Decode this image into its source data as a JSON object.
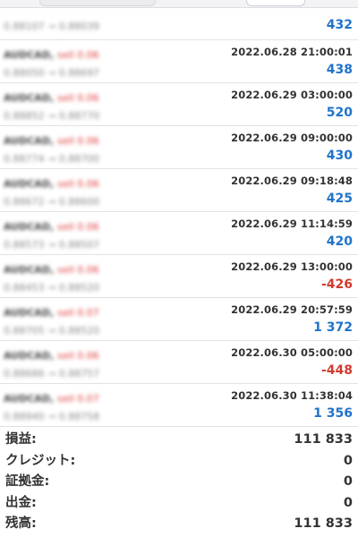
{
  "colors": {
    "profit_positive": "#2173c9",
    "profit_negative": "#d23b2e",
    "sell_side": "#e03a3a"
  },
  "deals": [
    {
      "symbol": "AUDCAD,",
      "side": "sell 0.06",
      "prices": "0.88107 → 0.88039",
      "time": "",
      "profit": "432",
      "negative": false
    },
    {
      "symbol": "AUDCAD,",
      "side": "sell 0.06",
      "prices": "0.88050 → 0.88697",
      "time": "2022.06.28 21:00:01",
      "profit": "438",
      "negative": false
    },
    {
      "symbol": "AUDCAD,",
      "side": "sell 0.06",
      "prices": "0.88852 → 0.88770",
      "time": "2022.06.29 03:00:00",
      "profit": "520",
      "negative": false
    },
    {
      "symbol": "AUDCAD,",
      "side": "sell 0.06",
      "prices": "0.88774 → 0.88700",
      "time": "2022.06.29 09:00:00",
      "profit": "430",
      "negative": false
    },
    {
      "symbol": "AUDCAD,",
      "side": "sell 0.06",
      "prices": "0.88672 → 0.88600",
      "time": "2022.06.29 09:18:48",
      "profit": "425",
      "negative": false
    },
    {
      "symbol": "AUDCAD,",
      "side": "sell 0.06",
      "prices": "0.88573 → 0.88507",
      "time": "2022.06.29 11:14:59",
      "profit": "420",
      "negative": false
    },
    {
      "symbol": "AUDCAD,",
      "side": "sell 0.06",
      "prices": "0.88453 → 0.88520",
      "time": "2022.06.29 13:00:00",
      "profit": "-426",
      "negative": true
    },
    {
      "symbol": "AUDCAD,",
      "side": "sell 0.07",
      "prices": "0.88705 → 0.88520",
      "time": "2022.06.29 20:57:59",
      "profit": "1 372",
      "negative": false
    },
    {
      "symbol": "AUDCAD,",
      "side": "sell 0.06",
      "prices": "0.88686 → 0.88757",
      "time": "2022.06.30 05:00:00",
      "profit": "-448",
      "negative": true
    },
    {
      "symbol": "AUDCAD,",
      "side": "sell 0.07",
      "prices": "0.88940 → 0.88758",
      "time": "2022.06.30 11:38:04",
      "profit": "1 356",
      "negative": false
    }
  ],
  "summary": [
    {
      "label": "損益:",
      "value": "111 833"
    },
    {
      "label": "クレジット:",
      "value": "0"
    },
    {
      "label": "証拠金:",
      "value": "0"
    },
    {
      "label": "出金:",
      "value": "0"
    },
    {
      "label": "残高:",
      "value": "111 833"
    }
  ]
}
